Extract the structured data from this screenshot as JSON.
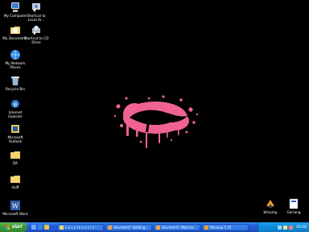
{
  "desktop_icons": [
    {
      "label": "My Computer",
      "icon": "computer-icon"
    },
    {
      "label": "Shortcut to\nLocal Ar...",
      "icon": "shortcut-icon"
    },
    {
      "label": "My Documents",
      "icon": "folder-docs-icon"
    },
    {
      "label": "Shortcut to CD\nDrive",
      "icon": "cd-drive-icon"
    },
    {
      "label": "My Network\nPlaces",
      "icon": "network-icon"
    },
    {
      "label": "Recycle Bin",
      "icon": "recycle-bin-icon"
    },
    {
      "label": "Internet\nExplorer",
      "icon": "internet-explorer-icon"
    },
    {
      "label": "Microsoft\nOutlook",
      "icon": "outlook-icon"
    },
    {
      "label": "DA",
      "icon": "folder-icon"
    },
    {
      "label": "stuff",
      "icon": "folder-icon"
    },
    {
      "label": "Microsoft Word",
      "icon": "word-icon"
    },
    {
      "label": "Winamp",
      "icon": "winamp-icon"
    },
    {
      "label": "Gerrang",
      "icon": "gerrang-icon"
    }
  ],
  "taskbar": {
    "start_label": "start",
    "tasks": [
      {
        "label": "v e s u l k o v s r s . . .",
        "icon": "folder-window-icon"
      },
      {
        "label": "devnet447: Ketding...",
        "icon": "browser-window-icon"
      },
      {
        "label": "devnet447: Mdsche...",
        "icon": "browser-window-icon"
      },
      {
        "label": "Winamp 5.37",
        "icon": "winamp-icon"
      }
    ],
    "clock": "20:08"
  },
  "colors": {
    "wallpaper": "#000000",
    "splat": "#f06292",
    "taskbar": "#245edb",
    "start": "#3c9a3c",
    "tray": "#0f8ad8"
  }
}
